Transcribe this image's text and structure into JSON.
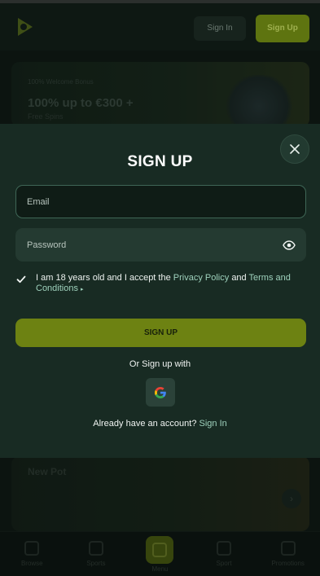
{
  "background": {
    "header": {
      "signin_label": "Sign In",
      "signup_label": "Sign Up"
    },
    "promo": {
      "small_text": "100% Welcome Bonus",
      "big_text": "100% up to €300 +",
      "sub_text": "Free Spins"
    },
    "promo2": {
      "text": "New Pot"
    },
    "bottom_nav": [
      {
        "label": "Browse"
      },
      {
        "label": "Sports"
      },
      {
        "label": "Menu"
      },
      {
        "label": "Sport"
      },
      {
        "label": "Promotions"
      }
    ]
  },
  "modal": {
    "title": "SIGN UP",
    "email": {
      "placeholder": "Email",
      "value": ""
    },
    "password": {
      "placeholder": "Password",
      "value": ""
    },
    "consent": {
      "text_before": "I am 18 years old and I accept the",
      "privacy_link": "Privacy Policy",
      "and_text": "and",
      "terms_link": "Terms and Conditions",
      "arrow": "▸"
    },
    "signup_button": "SIGN UP",
    "or_text": "Or Sign up with",
    "account_text": "Already have an account?",
    "signin_link": "Sign In"
  },
  "colors": {
    "modal_bg": "#182b23",
    "accent_green": "#6d8212",
    "link": "#9ed1bc",
    "email_border": "#3f6656"
  },
  "icons": [
    "close-icon",
    "eye-icon",
    "checkmark-icon",
    "google-icon",
    "logo-icon"
  ]
}
